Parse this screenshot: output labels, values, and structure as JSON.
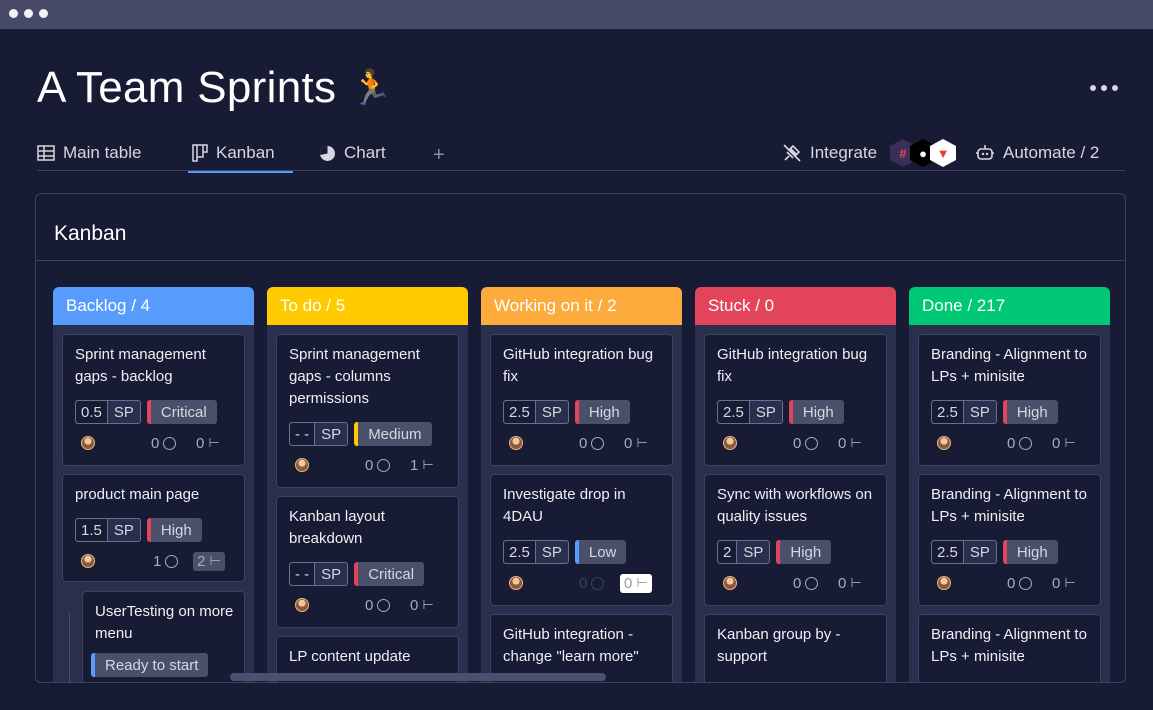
{
  "window": {
    "title": "A Team Sprints",
    "title_emoji": "🏃"
  },
  "tabs": [
    {
      "label": "Main table",
      "icon": "table-icon"
    },
    {
      "label": "Kanban",
      "icon": "kanban-icon",
      "active": true
    },
    {
      "label": "Chart",
      "icon": "chart-icon"
    }
  ],
  "toolbar": {
    "add_tab": "+",
    "integrate": "Integrate",
    "automate": "Automate / 2"
  },
  "panel": {
    "title": "Kanban"
  },
  "colors": {
    "backlog": "#579bfc",
    "todo": "#ffcb00",
    "working": "#fdab3d",
    "stuck": "#e2445c",
    "done": "#00c875",
    "critical": "#e2445c",
    "high": "#e2445c",
    "medium": "#ffcb00",
    "low": "#579bfc",
    "ready": "#579bfc"
  },
  "columns": [
    {
      "header": "Backlog / 4",
      "cards": [
        {
          "title": "Sprint management gaps - backlog",
          "sp": "0.5",
          "sp_label": "SP",
          "priority": "Critical",
          "comments": "0",
          "subitems": "0"
        },
        {
          "title": "product main page",
          "sp": "1.5",
          "sp_label": "SP",
          "priority": "High",
          "comments": "1",
          "subitems": "2"
        },
        {
          "title": "UserTesting on more menu",
          "status": "Ready to start"
        }
      ]
    },
    {
      "header": "To do / 5",
      "cards": [
        {
          "title": "Sprint management gaps - columns permissions",
          "sp": "- -",
          "sp_label": "SP",
          "priority": "Medium",
          "comments": "0",
          "subitems": "1"
        },
        {
          "title": "Kanban layout breakdown",
          "sp": "- -",
          "sp_label": "SP",
          "priority": "Critical",
          "comments": "0",
          "subitems": "0"
        },
        {
          "title": "LP content update"
        }
      ]
    },
    {
      "header": "Working on it / 2",
      "cards": [
        {
          "title": "GitHub integration bug fix",
          "sp": "2.5",
          "sp_label": "SP",
          "priority": "High",
          "comments": "0",
          "subitems": "0"
        },
        {
          "title": "Investigate drop in 4DAU",
          "sp": "2.5",
          "sp_label": "SP",
          "priority": "Low",
          "comments": "0",
          "subitems": "0"
        },
        {
          "title": "GitHub integration - change \"learn more\""
        }
      ]
    },
    {
      "header": "Stuck / 0",
      "cards": [
        {
          "title": "GitHub integration bug fix",
          "sp": "2.5",
          "sp_label": "SP",
          "priority": "High",
          "comments": "0",
          "subitems": "0"
        },
        {
          "title": "Sync with workflows on quality issues",
          "sp": "2",
          "sp_label": "SP",
          "priority": "High",
          "comments": "0",
          "subitems": "0"
        },
        {
          "title": "Kanban group by - support"
        }
      ]
    },
    {
      "header": "Done  / 217",
      "cards": [
        {
          "title": "Branding  - Alignment to LPs + minisite",
          "sp": "2.5",
          "sp_label": "SP",
          "priority": "High",
          "comments": "0",
          "subitems": "0"
        },
        {
          "title": "Branding  - Alignment to LPs + minisite",
          "sp": "2.5",
          "sp_label": "SP",
          "priority": "High",
          "comments": "0",
          "subitems": "0"
        },
        {
          "title": "Branding  - Alignment to LPs + minisite"
        }
      ]
    }
  ]
}
